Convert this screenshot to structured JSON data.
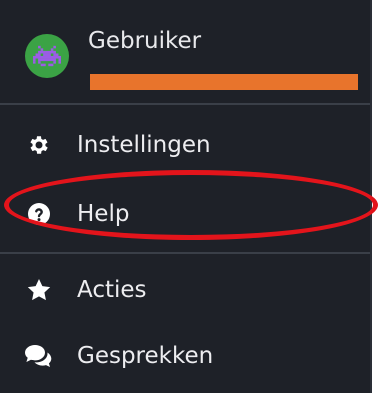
{
  "user": {
    "name": "Gebruiker",
    "avatar_icon": "space-invader-icon",
    "progress": 1.0,
    "progress_color": "#e8742c",
    "avatar_color": "#3ba345"
  },
  "menu": {
    "items": [
      {
        "label": "Instellingen",
        "icon": "gear-icon"
      },
      {
        "label": "Help",
        "icon": "question-circle-icon"
      },
      {
        "label": "Acties",
        "icon": "star-icon"
      },
      {
        "label": "Gesprekken",
        "icon": "comments-icon"
      }
    ]
  },
  "colors": {
    "background": "#1e2128",
    "text": "#ededf0",
    "highlight": "#e3141b"
  }
}
